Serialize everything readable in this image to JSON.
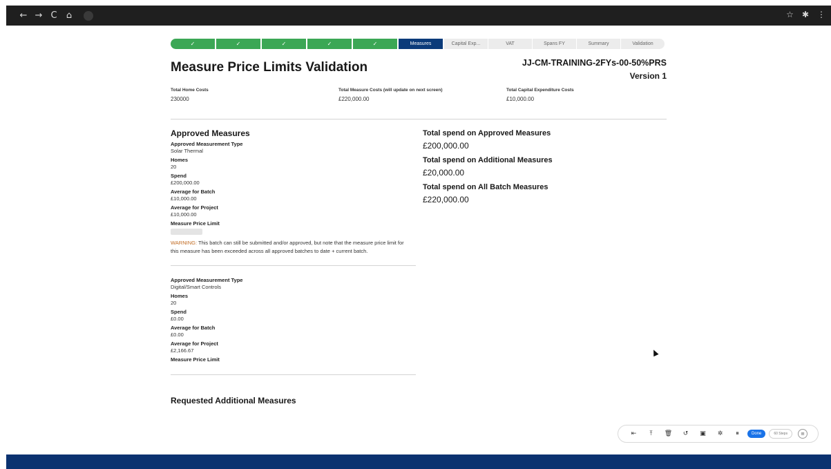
{
  "browser": {
    "back_icon": "←",
    "forward_icon": "→",
    "reload_icon": "C",
    "home_icon": "⌂",
    "star_icon": "☆",
    "extension_icon": "✱",
    "menu_icon": "⋮"
  },
  "path": {
    "completed_steps": [
      "✓",
      "✓",
      "✓",
      "✓",
      "✓"
    ],
    "current_step": "Measures",
    "todo_steps": [
      "Capital Exp...",
      "VAT",
      "Spans FY",
      "Summary",
      "Validation"
    ]
  },
  "header": {
    "title": "Measure Price Limits Validation",
    "record_name": "JJ-CM-TRAINING-2FYs-00-50%PRS",
    "version": "Version 1"
  },
  "summary": {
    "home_costs_label": "Total Home Costs",
    "home_costs_value": "230000",
    "measure_costs_label": "Total Measure Costs (will update on next screen)",
    "measure_costs_value": "£220,000.00",
    "capex_label": "Total Capital Expenditure Costs",
    "capex_value": "£10,000.00"
  },
  "approved": {
    "title": "Approved Measures",
    "measures": [
      {
        "type_label": "Approved Measurement Type",
        "type_value": "Solar Thermal",
        "homes_label": "Homes",
        "homes_value": "20",
        "spend_label": "Spend",
        "spend_value": "£200,000.00",
        "avg_batch_label": "Average for Batch",
        "avg_batch_value": "£10,000.00",
        "avg_project_label": "Average for Project",
        "avg_project_value": "£10,000.00",
        "limit_label": "Measure Price Limit"
      },
      {
        "type_label": "Approved Measurement Type",
        "type_value": "Digital/Smart Controls",
        "homes_label": "Homes",
        "homes_value": "20",
        "spend_label": "Spend",
        "spend_value": "£0.00",
        "avg_batch_label": "Average for Batch",
        "avg_batch_value": "£0.00",
        "avg_project_label": "Average for Project",
        "avg_project_value": "£2,166.67",
        "limit_label": "Measure Price Limit"
      }
    ],
    "warning_word": "WARNING:",
    "warning_text": " This batch can still be submitted and/or approved, but note that the measure price limit for this measure has been exceeded across all approved batches to date + current batch."
  },
  "additional": {
    "title": "Requested Additional Measures"
  },
  "totals": {
    "approved_label": "Total spend on Approved Measures",
    "approved_value": "£200,000.00",
    "additional_label": "Total spend on Additional Measures",
    "additional_value": "£20,000.00",
    "all_label": "Total spend on All Batch Measures",
    "all_value": "£220,000.00"
  },
  "recorder": {
    "icons": [
      "⇤",
      "⤒",
      "🗑",
      "↺",
      "▣",
      "✲",
      "⏸"
    ],
    "done_label": "Done",
    "steps_label": "60 Steps",
    "menu_icon": "≡"
  },
  "colors": {
    "path_complete": "#3ba755",
    "path_current": "#0b3b7a",
    "path_todo": "#ececec",
    "warning": "#c16a20",
    "bottom_bar": "#0b3270"
  }
}
